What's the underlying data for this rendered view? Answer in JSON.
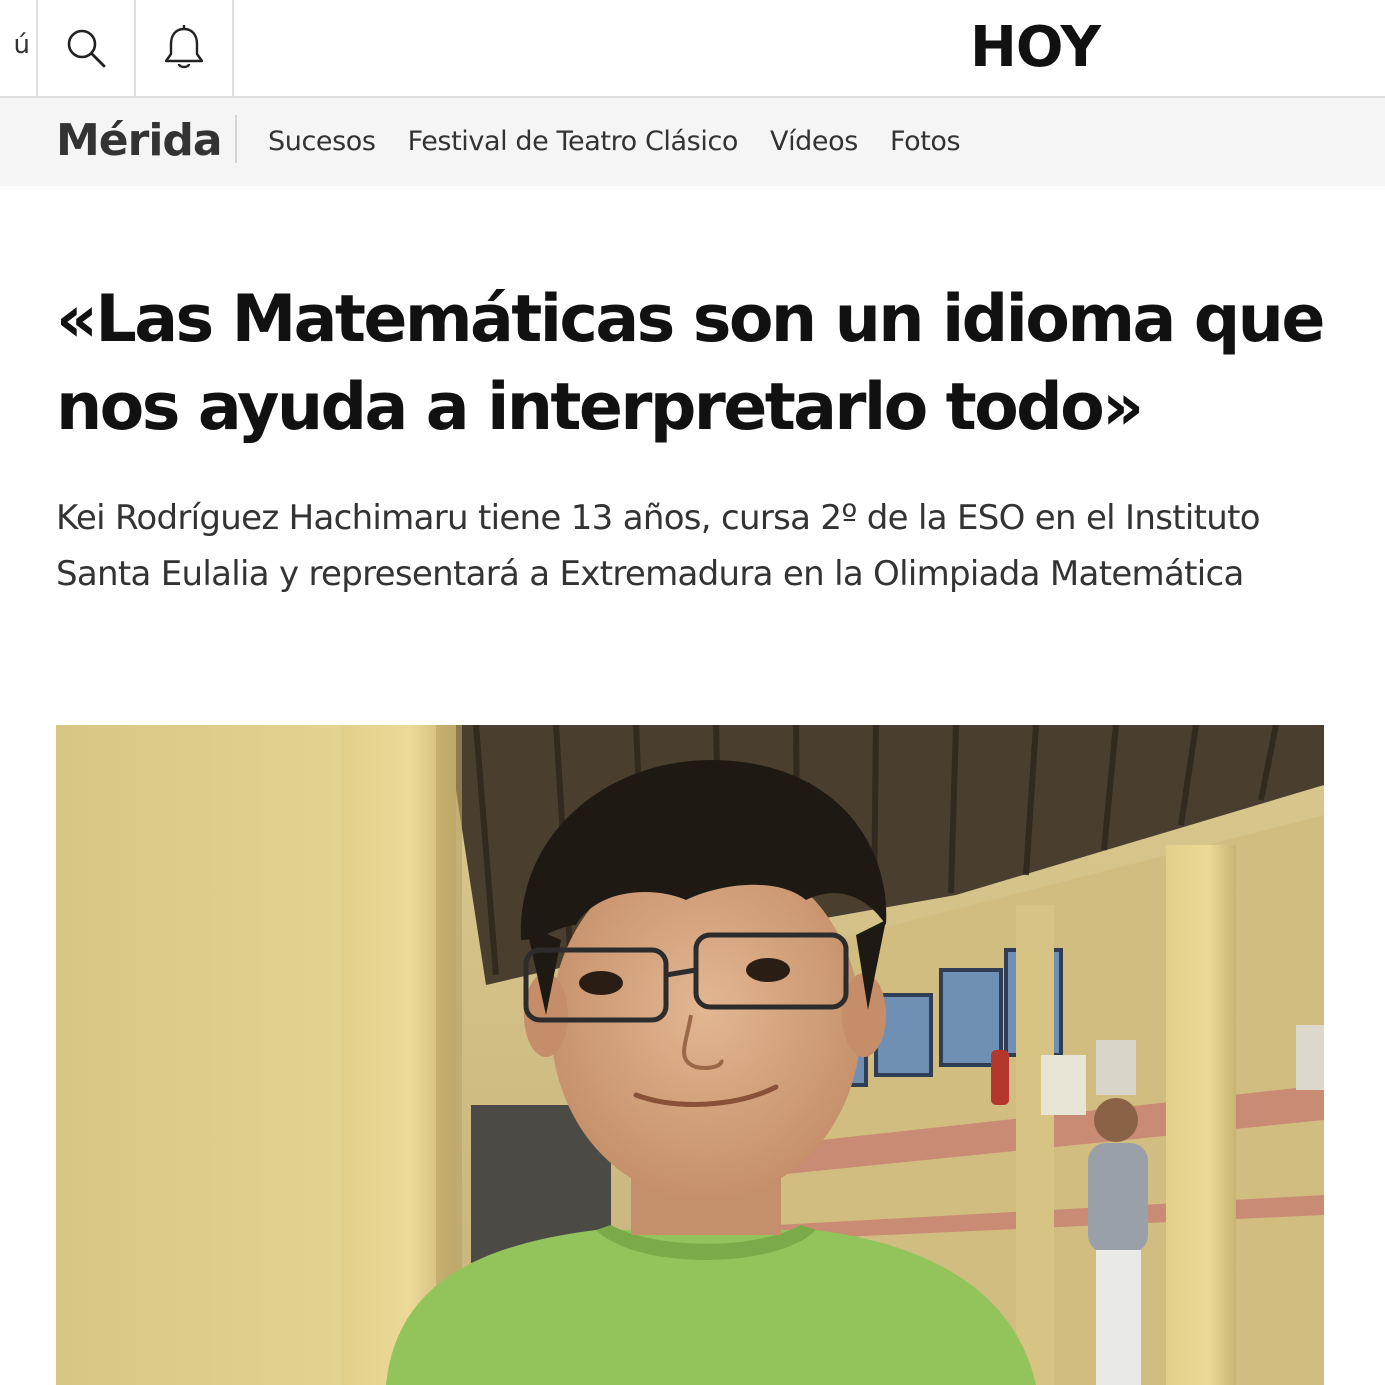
{
  "topbar": {
    "menu_stub_glyph": "ú",
    "search_icon": "search-icon",
    "notifications_icon": "bell-icon",
    "logo": "HOY"
  },
  "section_nav": {
    "title": "Mérida",
    "links": [
      "Sucesos",
      "Festival de Teatro Clásico",
      "Vídeos",
      "Fotos"
    ]
  },
  "article": {
    "headline": "«Las Matemáticas son un idioma que nos ayuda a interpretarlo todo»",
    "subtitle": "Kei Rodríguez Hachimaru tiene 13 años, cursa 2º de la ESO en el Instituto Santa Eulalia y representará a Extremadura en la Olimpiada Matemática"
  },
  "colors": {
    "border": "#dedede",
    "nav_background": "#f5f5f5",
    "text_primary": "#111111",
    "text_secondary": "#333333"
  }
}
